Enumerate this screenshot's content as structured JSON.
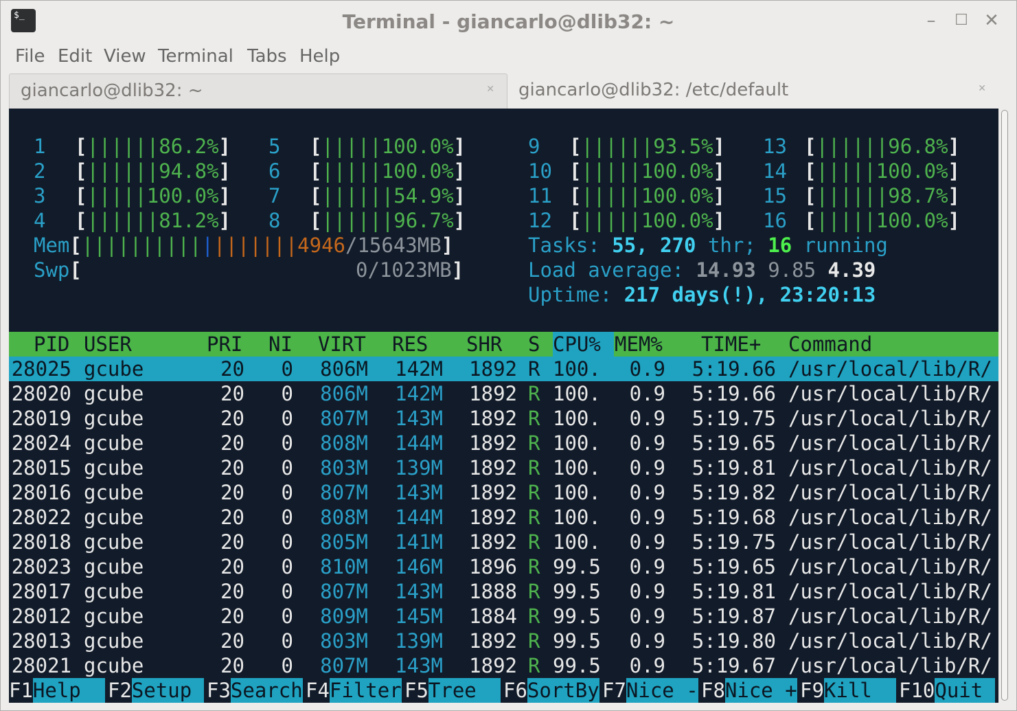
{
  "window": {
    "title": "Terminal - giancarlo@dlib32: ~",
    "icon_text": "$_"
  },
  "menu": [
    "File",
    "Edit",
    "View",
    "Terminal",
    "Tabs",
    "Help"
  ],
  "tabs": [
    {
      "label": "giancarlo@dlib32: ~",
      "active": true
    },
    {
      "label": "giancarlo@dlib32: /etc/default",
      "active": false
    }
  ],
  "cpus": [
    {
      "id": "1",
      "bar": "||||||",
      "pct": "86.2%"
    },
    {
      "id": "2",
      "bar": "||||||",
      "pct": "94.8%"
    },
    {
      "id": "3",
      "bar": "|||||",
      "pct": "100.0%"
    },
    {
      "id": "4",
      "bar": "||||||",
      "pct": "81.2%"
    },
    {
      "id": "5",
      "bar": "|||||",
      "pct": "100.0%"
    },
    {
      "id": "6",
      "bar": "|||||",
      "pct": "100.0%"
    },
    {
      "id": "7",
      "bar": "||||||",
      "pct": "54.9%"
    },
    {
      "id": "8",
      "bar": "||||||",
      "pct": "96.7%"
    },
    {
      "id": "9",
      "bar": "||||||",
      "pct": "93.5%"
    },
    {
      "id": "10",
      "bar": "|||||",
      "pct": "100.0%"
    },
    {
      "id": "11",
      "bar": "|||||",
      "pct": "100.0%"
    },
    {
      "id": "12",
      "bar": "|||||",
      "pct": "100.0%"
    },
    {
      "id": "13",
      "bar": "||||||",
      "pct": "96.8%"
    },
    {
      "id": "14",
      "bar": "|||||",
      "pct": "100.0%"
    },
    {
      "id": "15",
      "bar": "||||||",
      "pct": "98.7%"
    },
    {
      "id": "16",
      "bar": "|||||",
      "pct": "100.0%"
    }
  ],
  "mem": {
    "label": "Mem",
    "bar_green": "||||||||||",
    "bar_blue": "|",
    "bar_orange": "|||||||",
    "used": "4946",
    "total": "15643MB"
  },
  "swp": {
    "label": "Swp",
    "value": "0/1023MB"
  },
  "tasks": {
    "label": "Tasks:",
    "count": "55",
    "threads": "270",
    "thr_label": "thr;",
    "running": "16",
    "running_label": "running"
  },
  "load": {
    "label": "Load average:",
    "one": "14.93",
    "five": "9.85",
    "fifteen": "4.39"
  },
  "uptime": {
    "label": "Uptime:",
    "value": "217 days(!), 23:20:13"
  },
  "columns": [
    "PID",
    "USER",
    "PRI",
    "NI",
    "VIRT",
    "RES",
    "SHR",
    "S",
    "CPU%",
    "MEM%",
    "TIME+",
    "Command"
  ],
  "processes": [
    {
      "pid": "28025",
      "user": "gcube",
      "pri": "20",
      "ni": "0",
      "virt": "806M",
      "res": "142M",
      "shr": "1892",
      "s": "R",
      "cpu": "100.",
      "mem": "0.9",
      "time": "5:19.66",
      "cmd": "/usr/local/lib/R/"
    },
    {
      "pid": "28020",
      "user": "gcube",
      "pri": "20",
      "ni": "0",
      "virt": "806M",
      "res": "142M",
      "shr": "1892",
      "s": "R",
      "cpu": "100.",
      "mem": "0.9",
      "time": "5:19.66",
      "cmd": "/usr/local/lib/R/"
    },
    {
      "pid": "28019",
      "user": "gcube",
      "pri": "20",
      "ni": "0",
      "virt": "807M",
      "res": "143M",
      "shr": "1892",
      "s": "R",
      "cpu": "100.",
      "mem": "0.9",
      "time": "5:19.75",
      "cmd": "/usr/local/lib/R/"
    },
    {
      "pid": "28024",
      "user": "gcube",
      "pri": "20",
      "ni": "0",
      "virt": "808M",
      "res": "144M",
      "shr": "1892",
      "s": "R",
      "cpu": "100.",
      "mem": "0.9",
      "time": "5:19.65",
      "cmd": "/usr/local/lib/R/"
    },
    {
      "pid": "28015",
      "user": "gcube",
      "pri": "20",
      "ni": "0",
      "virt": "803M",
      "res": "139M",
      "shr": "1892",
      "s": "R",
      "cpu": "100.",
      "mem": "0.9",
      "time": "5:19.81",
      "cmd": "/usr/local/lib/R/"
    },
    {
      "pid": "28016",
      "user": "gcube",
      "pri": "20",
      "ni": "0",
      "virt": "807M",
      "res": "143M",
      "shr": "1892",
      "s": "R",
      "cpu": "100.",
      "mem": "0.9",
      "time": "5:19.82",
      "cmd": "/usr/local/lib/R/"
    },
    {
      "pid": "28022",
      "user": "gcube",
      "pri": "20",
      "ni": "0",
      "virt": "808M",
      "res": "144M",
      "shr": "1892",
      "s": "R",
      "cpu": "100.",
      "mem": "0.9",
      "time": "5:19.68",
      "cmd": "/usr/local/lib/R/"
    },
    {
      "pid": "28018",
      "user": "gcube",
      "pri": "20",
      "ni": "0",
      "virt": "805M",
      "res": "141M",
      "shr": "1892",
      "s": "R",
      "cpu": "100.",
      "mem": "0.9",
      "time": "5:19.75",
      "cmd": "/usr/local/lib/R/"
    },
    {
      "pid": "28023",
      "user": "gcube",
      "pri": "20",
      "ni": "0",
      "virt": "810M",
      "res": "146M",
      "shr": "1896",
      "s": "R",
      "cpu": "99.5",
      "mem": "0.9",
      "time": "5:19.65",
      "cmd": "/usr/local/lib/R/"
    },
    {
      "pid": "28017",
      "user": "gcube",
      "pri": "20",
      "ni": "0",
      "virt": "807M",
      "res": "143M",
      "shr": "1888",
      "s": "R",
      "cpu": "99.5",
      "mem": "0.9",
      "time": "5:19.81",
      "cmd": "/usr/local/lib/R/"
    },
    {
      "pid": "28012",
      "user": "gcube",
      "pri": "20",
      "ni": "0",
      "virt": "809M",
      "res": "145M",
      "shr": "1884",
      "s": "R",
      "cpu": "99.5",
      "mem": "0.9",
      "time": "5:19.87",
      "cmd": "/usr/local/lib/R/"
    },
    {
      "pid": "28013",
      "user": "gcube",
      "pri": "20",
      "ni": "0",
      "virt": "803M",
      "res": "139M",
      "shr": "1892",
      "s": "R",
      "cpu": "99.5",
      "mem": "0.9",
      "time": "5:19.80",
      "cmd": "/usr/local/lib/R/"
    },
    {
      "pid": "28021",
      "user": "gcube",
      "pri": "20",
      "ni": "0",
      "virt": "807M",
      "res": "143M",
      "shr": "1892",
      "s": "R",
      "cpu": "99.5",
      "mem": "0.9",
      "time": "5:19.67",
      "cmd": "/usr/local/lib/R/"
    }
  ],
  "footer": [
    {
      "key": "F1",
      "label": "Help  "
    },
    {
      "key": "F2",
      "label": "Setup "
    },
    {
      "key": "F3",
      "label": "Search"
    },
    {
      "key": "F4",
      "label": "Filter"
    },
    {
      "key": "F5",
      "label": "Tree  "
    },
    {
      "key": "F6",
      "label": "SortBy"
    },
    {
      "key": "F7",
      "label": "Nice -"
    },
    {
      "key": "F8",
      "label": "Nice +"
    },
    {
      "key": "F9",
      "label": "Kill  "
    },
    {
      "key": "F10",
      "label": "Quit "
    }
  ],
  "colors": {
    "terminal_bg": "#121b29",
    "header_green": "#4bb547",
    "selection_cyan": "#1fa3c0"
  }
}
